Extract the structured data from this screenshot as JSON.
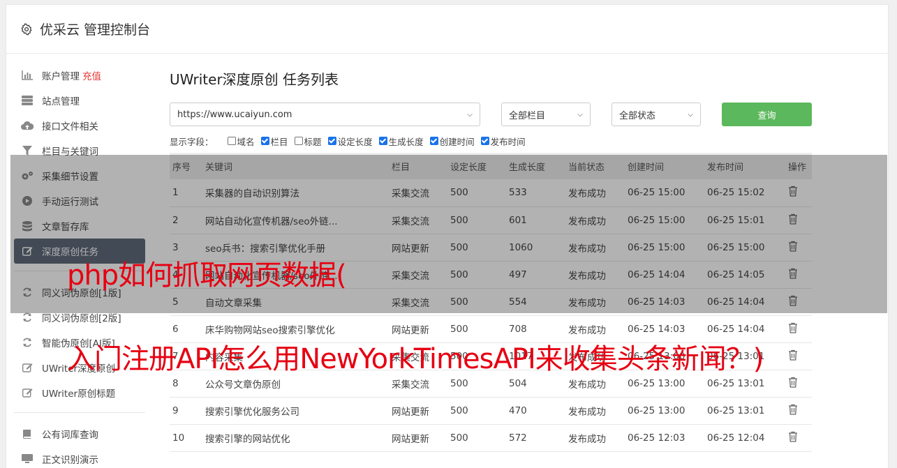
{
  "header": {
    "title": "优采云 管理控制台",
    "icon": "gear-icon"
  },
  "sidebar": {
    "items": [
      {
        "label": "账户管理",
        "extra": "充值",
        "icon": "bar-chart-icon"
      },
      {
        "label": "站点管理",
        "icon": "server-icon"
      },
      {
        "label": "接口文件相关",
        "icon": "cloud-upload-icon"
      },
      {
        "label": "栏目与关键词",
        "icon": "filter-icon"
      },
      {
        "label": "采集细节设置",
        "icon": "gears-icon"
      },
      {
        "label": "手动运行测试",
        "icon": "play-circle-icon"
      },
      {
        "label": "文章暂存库",
        "icon": "database-icon"
      },
      {
        "label": "深度原创任务",
        "icon": "edit-icon",
        "active": true
      },
      {
        "label": "同义词伪原创[1版]",
        "icon": "refresh-icon"
      },
      {
        "label": "同义词伪原创[2版]",
        "icon": "refresh-icon"
      },
      {
        "label": "智能伪原创[AI版]",
        "icon": "refresh-icon"
      },
      {
        "label": "UWriter深度原创",
        "icon": "edit-icon"
      },
      {
        "label": "UWriter原创标题",
        "icon": "edit-icon"
      },
      {
        "label": "公有词库查询",
        "icon": "book-icon"
      },
      {
        "label": "正文识别演示",
        "icon": "monitor-icon"
      }
    ]
  },
  "main": {
    "heading": "UWriter深度原创 任务列表",
    "site_select": "https://www.ucaiyun.com",
    "column_select": "全部栏目",
    "status_select": "全部状态",
    "query_button": "查询",
    "fields_label": "显示字段：",
    "fields": [
      {
        "label": "域名",
        "checked": false
      },
      {
        "label": "栏目",
        "checked": true
      },
      {
        "label": "标题",
        "checked": false
      },
      {
        "label": "设定长度",
        "checked": true
      },
      {
        "label": "生成长度",
        "checked": true
      },
      {
        "label": "创建时间",
        "checked": true
      },
      {
        "label": "发布时间",
        "checked": true
      }
    ],
    "table": {
      "headers": [
        "序号",
        "关键词",
        "栏目",
        "设定长度",
        "生成长度",
        "当前状态",
        "创建时间",
        "发布时间",
        "操作"
      ],
      "rows": [
        [
          "1",
          "采集器的自动识别算法",
          "采集交流",
          "500",
          "533",
          "发布成功",
          "06-25 15:00",
          "06-25 15:02"
        ],
        [
          "2",
          "网站自动化宣传机器/seo外链...",
          "采集交流",
          "500",
          "601",
          "发布成功",
          "06-25 15:00",
          "06-25 15:01"
        ],
        [
          "3",
          "seo兵书：搜索引擎优化手册",
          "网站更新",
          "500",
          "1060",
          "发布成功",
          "06-25 15:00",
          "06-25 15:00"
        ],
        [
          "4",
          "网站自动化宣传机器/seo外链...",
          "采集交流",
          "500",
          "497",
          "发布成功",
          "06-25 14:04",
          "06-25 14:05"
        ],
        [
          "5",
          "自动文章采集",
          "采集交流",
          "500",
          "554",
          "发布成功",
          "06-25 14:03",
          "06-25 14:04"
        ],
        [
          "6",
          "床华购物网站seo搜索引擎优化",
          "网站更新",
          "500",
          "708",
          "发布成功",
          "06-25 14:03",
          "06-25 14:04"
        ],
        [
          "7",
          "内容采集",
          "采集交流",
          "500",
          "1017",
          "发布成功",
          "06-25 13:00",
          "06-25 13:01"
        ],
        [
          "8",
          "公众号文章伪原创",
          "采集交流",
          "500",
          "504",
          "发布成功",
          "06-25 13:00",
          "06-25 13:01"
        ],
        [
          "9",
          "搜索引擎优化服务公司",
          "网站更新",
          "500",
          "470",
          "发布成功",
          "06-25 13:00",
          "06-25 13:01"
        ],
        [
          "10",
          "搜索引擎的网站优化",
          "网站更新",
          "500",
          "572",
          "发布成功",
          "06-25 12:03",
          "06-25 12:04"
        ]
      ]
    }
  },
  "overlay": {
    "line1": "php如何抓取网页数据(",
    "line2": "入门注册API怎么用NewYorkTimesAPI来收集头条新闻？)"
  },
  "colors": {
    "accent": "#5cb85c",
    "active_nav": "#5f6b7a",
    "success": "#3c9a3c",
    "overlay_text": "#e60012"
  }
}
